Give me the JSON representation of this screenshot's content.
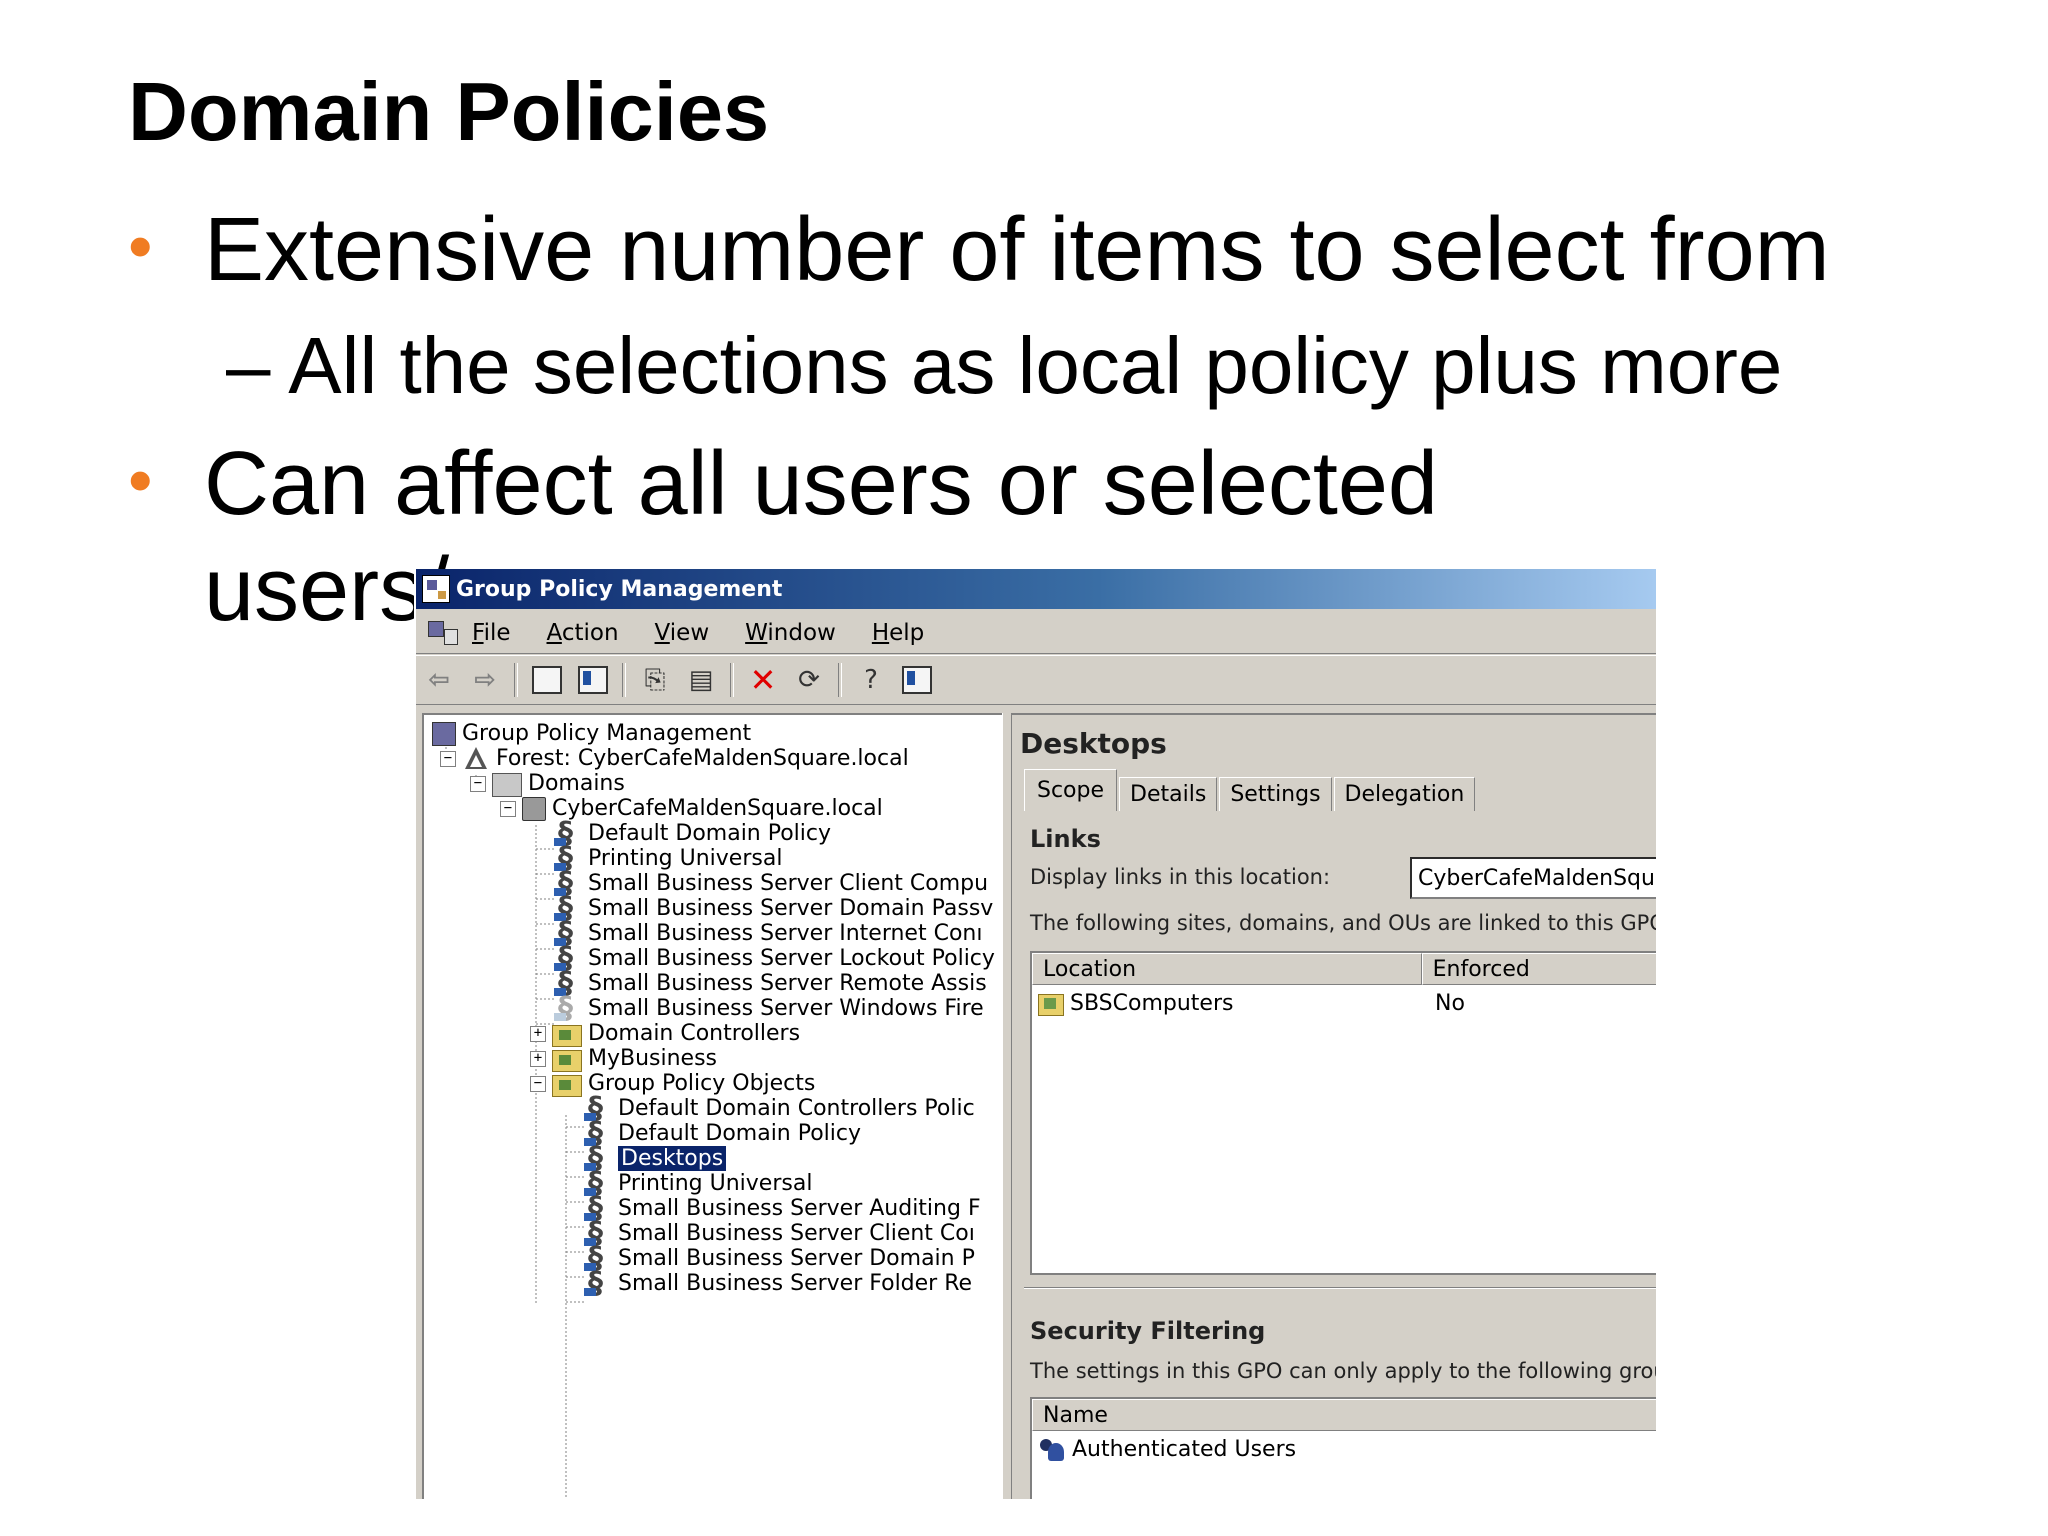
{
  "slide": {
    "title": "Domain Policies",
    "bullet1": "Extensive number of items to select from",
    "subbullet1": "– All the selections as local policy plus more",
    "bullet2_line1": "Can affect all users or selected",
    "bullet2_line2": "users/",
    "bullet_color": "#f07c22"
  },
  "window": {
    "title": "Group Policy Management",
    "menu": [
      "File",
      "Action",
      "View",
      "Window",
      "Help"
    ],
    "toolbar_icons": [
      "back-arrow-icon",
      "forward-arrow-icon",
      "up-folder-icon",
      "show-hide-tree-icon",
      "copy-icon",
      "paste-icon",
      "delete-icon",
      "refresh-icon",
      "help-icon",
      "properties-icon"
    ]
  },
  "tree": {
    "items": [
      {
        "label": "Group Policy Management",
        "icon": "gpm-icon",
        "expander": ""
      },
      {
        "label": "Forest: CyberCafeMaldenSquare.local",
        "icon": "forest-icon",
        "expander": "−"
      },
      {
        "label": "Domains",
        "icon": "domains-icon",
        "expander": "−"
      },
      {
        "label": "CyberCafeMaldenSquare.local",
        "icon": "domain-icon",
        "expander": "−"
      },
      {
        "label": "Default Domain Policy",
        "icon": "gpo-link-icon",
        "expander": ""
      },
      {
        "label": "Printing Universal",
        "icon": "gpo-link-icon",
        "expander": ""
      },
      {
        "label": "Small Business Server Client Compu",
        "icon": "gpo-link-icon",
        "expander": ""
      },
      {
        "label": "Small Business Server Domain Passv",
        "icon": "gpo-link-icon",
        "expander": ""
      },
      {
        "label": "Small Business Server Internet Conı",
        "icon": "gpo-link-icon",
        "expander": ""
      },
      {
        "label": "Small Business Server Lockout Policy",
        "icon": "gpo-link-icon",
        "expander": ""
      },
      {
        "label": "Small Business Server Remote Assis",
        "icon": "gpo-link-icon",
        "expander": ""
      },
      {
        "label": "Small Business Server Windows Fire",
        "icon": "gpo-link-disabled-icon",
        "expander": ""
      },
      {
        "label": "Domain Controllers",
        "icon": "ou-icon",
        "expander": "+"
      },
      {
        "label": "MyBusiness",
        "icon": "ou-icon",
        "expander": "+"
      },
      {
        "label": "Group Policy Objects",
        "icon": "gpo-folder-icon",
        "expander": "−"
      },
      {
        "label": "Default Domain Controllers Polic",
        "icon": "gpo-icon",
        "expander": ""
      },
      {
        "label": "Default Domain Policy",
        "icon": "gpo-icon",
        "expander": ""
      },
      {
        "label": "Desktops",
        "icon": "gpo-icon",
        "expander": "",
        "selected": true
      },
      {
        "label": "Printing Universal",
        "icon": "gpo-icon",
        "expander": ""
      },
      {
        "label": "Small Business Server Auditing F",
        "icon": "gpo-icon",
        "expander": ""
      },
      {
        "label": "Small Business Server Client Coı",
        "icon": "gpo-icon",
        "expander": ""
      },
      {
        "label": "Small Business Server Domain P",
        "icon": "gpo-icon",
        "expander": ""
      },
      {
        "label": "Small Business Server Folder Re",
        "icon": "gpo-icon",
        "expander": ""
      }
    ]
  },
  "detail": {
    "title": "Desktops",
    "tabs": [
      "Scope",
      "Details",
      "Settings",
      "Delegation"
    ],
    "links_heading": "Links",
    "display_links_label": "Display links in this location:",
    "display_links_value": "CyberCafeMaldenSquare.",
    "linked_text": "The following sites, domains, and OUs are linked to this GPO:",
    "links_columns": [
      "Location",
      "Enforced"
    ],
    "links_rows": [
      {
        "location": "SBSComputers",
        "enforced": "No"
      }
    ],
    "security_heading": "Security Filtering",
    "security_text": "The settings in this GPO can only apply to the following groups, u",
    "security_columns": [
      "Name"
    ],
    "security_rows": [
      {
        "name": "Authenticated Users"
      }
    ]
  }
}
